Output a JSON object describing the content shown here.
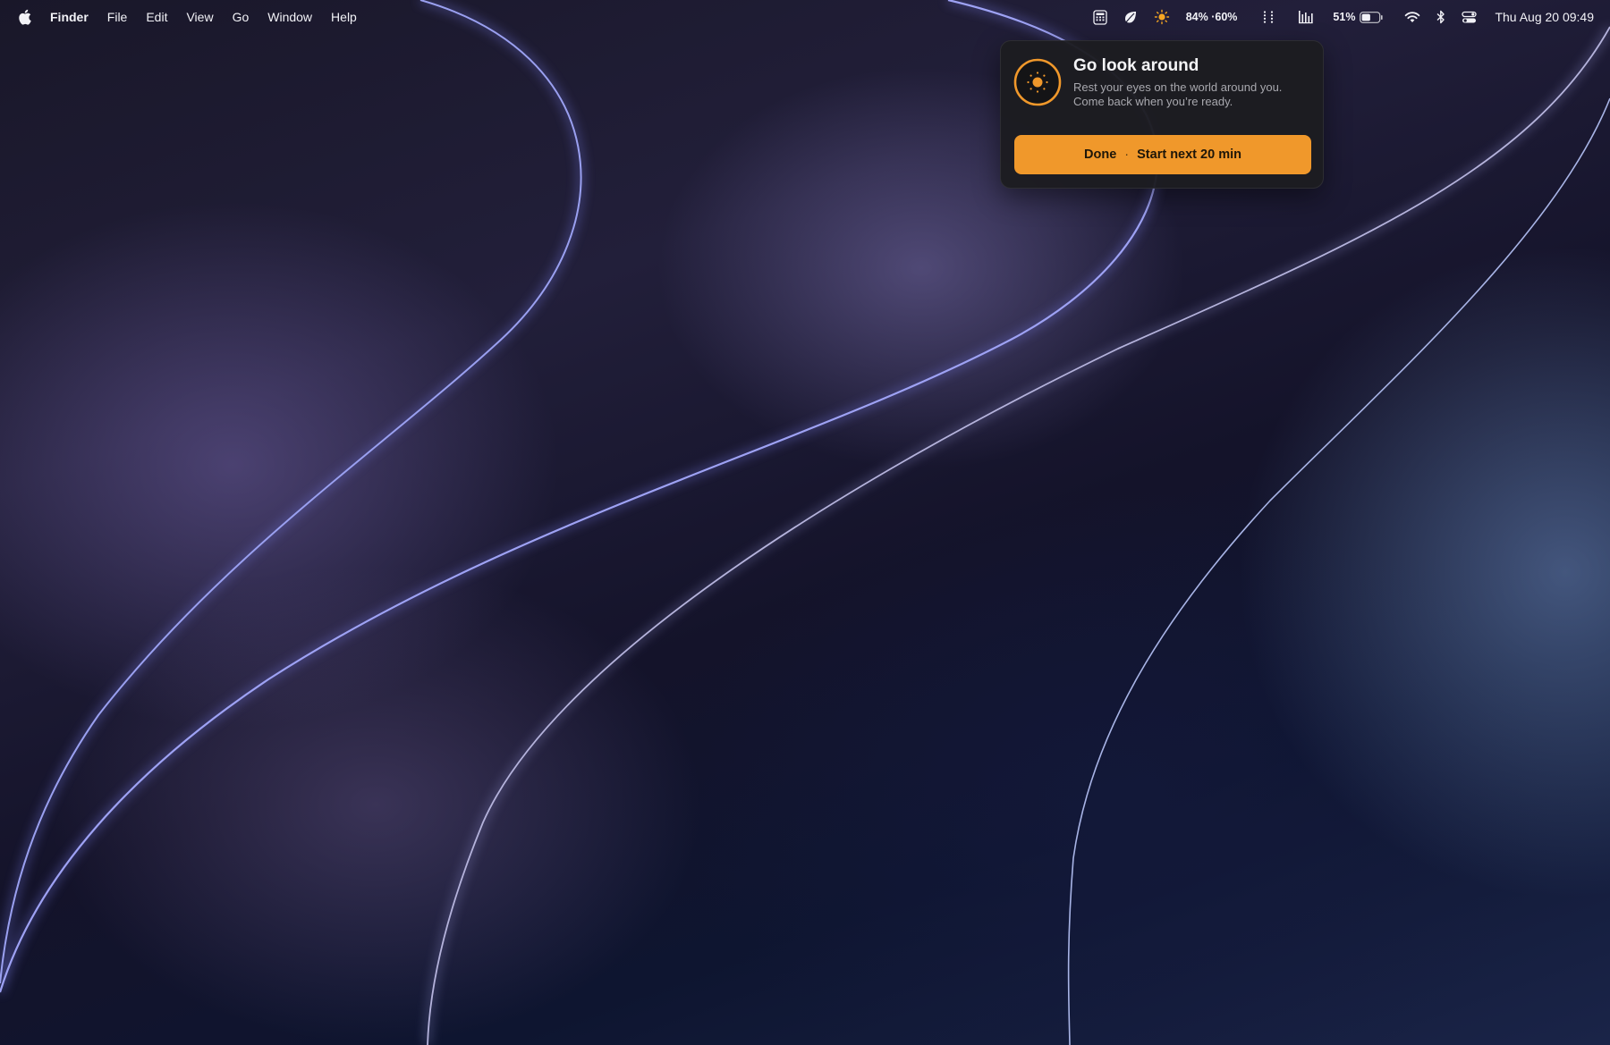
{
  "menubar": {
    "app_name": "Finder",
    "menus": [
      "File",
      "Edit",
      "View",
      "Go",
      "Window",
      "Help"
    ],
    "status": {
      "display_levels": "84% ·60%",
      "battery_percent": "51%",
      "battery_level": 0.51,
      "clock": "Thu Aug 20  09:49"
    },
    "icons": {
      "apple": "apple-logo-icon",
      "calculator": "calculator-icon",
      "leaf": "leaf-icon",
      "brightness": "sun-icon",
      "dots": "grid-dots-icon",
      "levels": "audio-levels-icon",
      "battery": "battery-icon",
      "wifi": "wifi-icon",
      "bluetooth": "bluetooth-icon",
      "control_center": "control-center-icon"
    }
  },
  "notification": {
    "icon": "sun-icon",
    "title": "Go look around",
    "body_line1": "Rest your eyes on the world around you.",
    "body_line2": "Come back when you’re ready.",
    "button_done": "Done",
    "button_separator": "·",
    "button_next": "Start next 20 min",
    "accent_color": "#f0982b"
  }
}
